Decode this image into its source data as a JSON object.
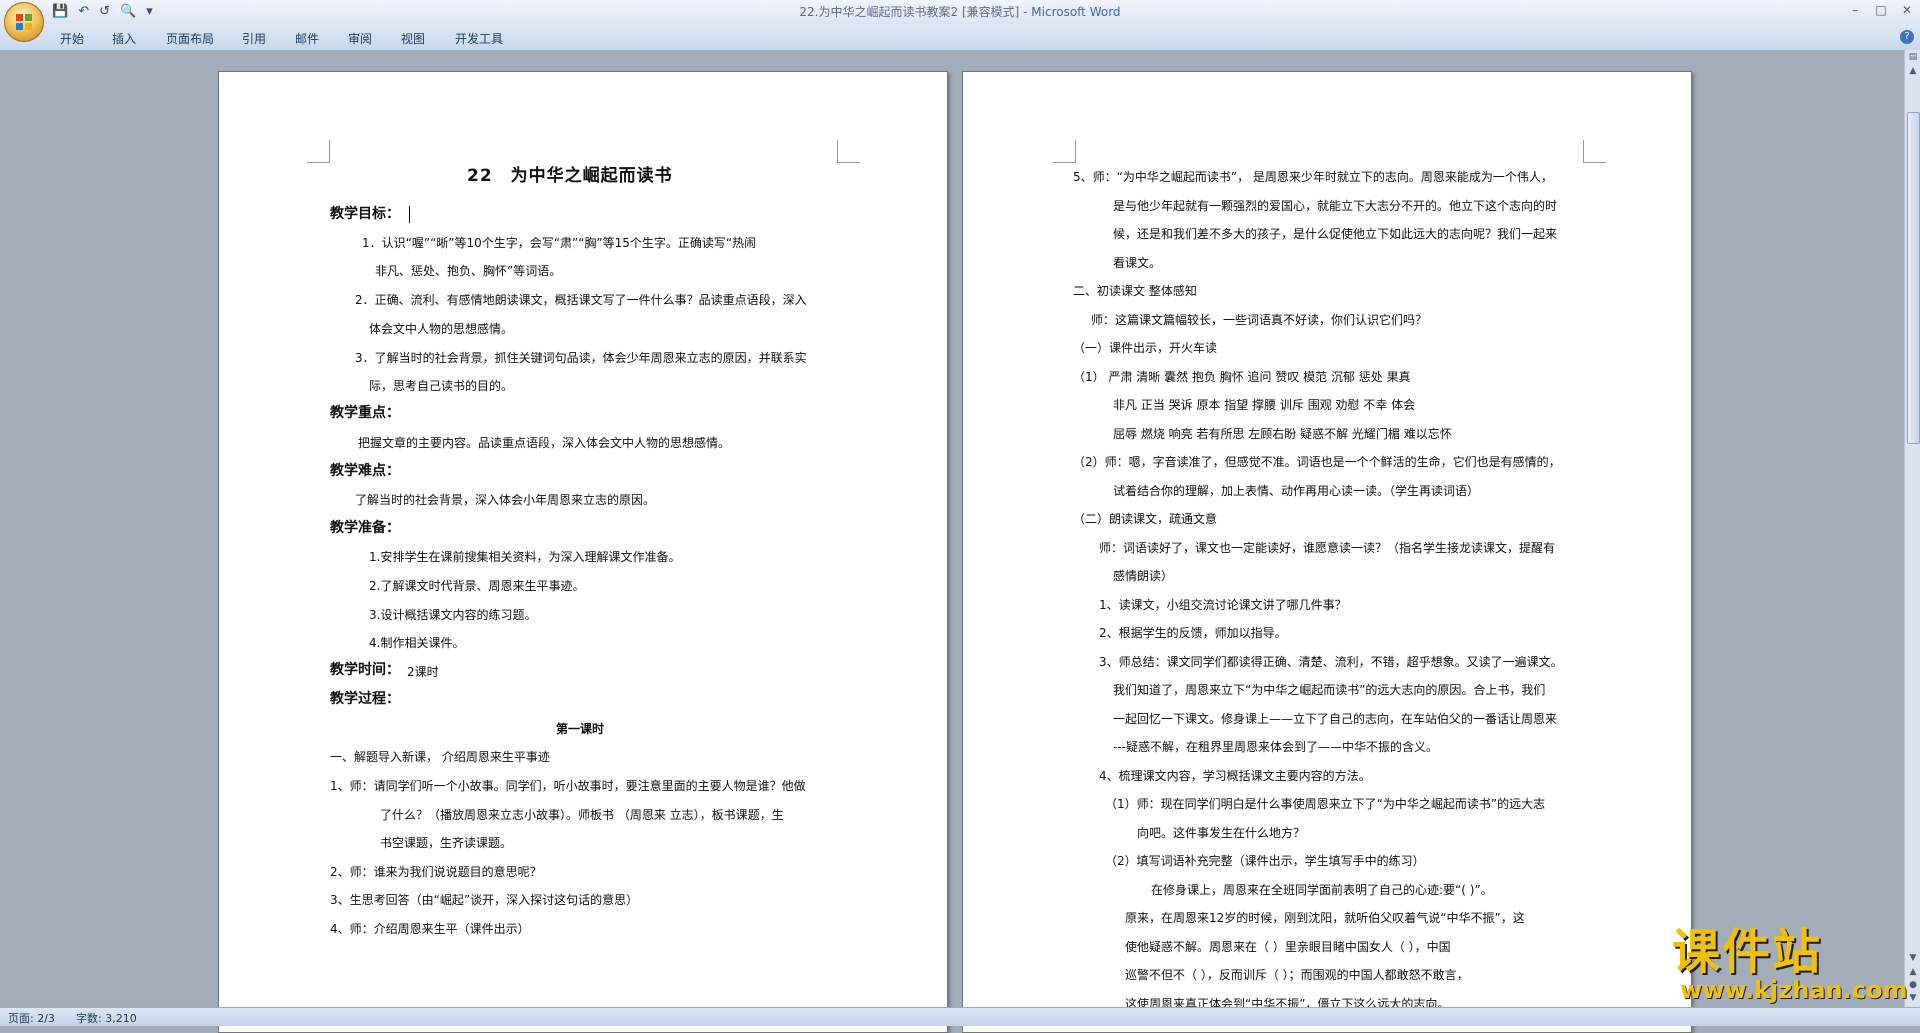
{
  "window": {
    "title": "22.为中华之崛起而读书教案2 [兼容模式] - ",
    "app_name": "Microsoft Word"
  },
  "ribbon_tabs": [
    "开始",
    "插入",
    "页面布局",
    "引用",
    "邮件",
    "审阅",
    "视图",
    "开发工具"
  ],
  "page1": {
    "title": "22　为中华之崛起而读书",
    "lines": [
      "教学目标：",
      "1．认识“喔”“晰”等10个生字，会写“肃”“胸”等15个生字。正确读写“热闹",
      "非凡、惩处、抱负、胸怀”等词语。",
      "2．正确、流利、有感情地朗读课文，概括课文写了一件什么事？品读重点语段，深入",
      "体会文中人物的思想感情。",
      "3．了解当时的社会背景，抓住关键词句品读，体会少年周恩来立志的原因，并联系实",
      "际，思考自己读书的目的。",
      "教学重点：",
      "把握文章的主要内容。品读重点语段，深入体会文中人物的思想感情。",
      "教学难点：",
      "了解当时的社会背景，深入体会小年周恩来立志的原因。",
      "教学准备：",
      "1.安排学生在课前搜集相关资料，为深入理解课文作准备。",
      "2.了解课文时代背景、周恩来生平事迹。",
      "3.设计概括课文内容的练习题。",
      "4.制作相关课件。",
      "教学时间：",
      "2课时",
      "教学过程：",
      "第一课时",
      "一、解题导入新课，  介绍周恩来生平事迹",
      "1、师：请同学们听一个小故事。同学们，听小故事时，要注意里面的主要人物是谁？他做",
      "了什么？（播放周恩来立志小故事）。师板书 （周恩来   立志），板书课题，生",
      "书空课题，生齐读课题。",
      "2、师：谁来为我们说说题目的意思呢？",
      "3、生思考回答（由“崛起”谈开，深入探讨这句话的意思）",
      "4、师：介绍周恩来生平（课件出示）"
    ]
  },
  "page2": {
    "lines": [
      "5、师：“为中华之崛起而读书”， 是周恩来少年时就立下的志向。周恩来能成为一个伟人，",
      "是与他少年起就有一颗强烈的爱国心，就能立下大志分不开的。他立下这个志向的时",
      "候，还是和我们差不多大的孩子，是什么促使他立下如此远大的志向呢？我们一起来",
      "看课文。",
      "二、初读课文 整体感知",
      "师：这篇课文篇幅较长，一些词语真不好读，你们认识它们吗？",
      "（一）课件出示，开火车读",
      "（1）  严肃   清晰   囊然   抱负   胸怀   追问   赞叹   模范   沉郁   惩处   果真",
      "非凡   正当   哭诉   原本   指望   撑腰   训斥   围观   劝慰   不幸   体会",
      "屈辱   燃烧   响亮   若有所思    左顾右盼   疑惑不解   光耀门楣   难以忘怀",
      "（2）师：嗯，字音读准了，但感觉不准。词语也是一个个鲜活的生命，它们也是有感情的，",
      "试着结合你的理解，加上表情、动作再用心读一读。（学生再读词语）",
      "（二）朗读课文，疏通文意",
      "师：词语读好了，课文也一定能读好，谁愿意读一读？（指名学生接龙读课文，提醒有",
      "感情朗读）",
      "1、读课文，小组交流讨论课文讲了哪几件事？",
      "2、根据学生的反馈，师加以指导。",
      "3、师总结：课文同学们都读得正确、清楚、流利，不错，超乎想象。又读了一遍课文。",
      "我们知道了，周恩来立下“为中华之崛起而读书”的远大志向的原因。合上书，我们",
      "一起回忆一下课文。修身课上——立下了自己的志向，在车站伯父的一番话让周恩来",
      "---疑惑不解，在租界里周恩来体会到了——中华不振的含义。",
      "4、梳理课文内容，学习概括课文主要内容的方法。",
      "（1）师：现在同学们明白是什么事使周恩来立下了“为中华之崛起而读书”的远大志",
      "向吧。这件事发生在什么地方？",
      "（2）填写词语补充完整（课件出示，学生填写手中的练习）",
      "在修身课上，周恩来在全班同学面前表明了自己的心迹:要“(                 )”。",
      "原来，在周恩来12岁的时候，刚到沈阳，就听伯父叹着气说“中华不振”，这",
      "使他疑惑不解。周恩来在（       ）里亲眼目睹中国女人（                  ），中国",
      "巡警不但不（          ），反而训斥（          ）；而围观的中国人都敢怒不敢言，",
      "这使周恩来真正体会到“中华不振”，僵立下这么远大的志向。"
    ]
  },
  "status": {
    "page": "页面: 2/3",
    "words": "字数: 3,210"
  },
  "watermark": {
    "text": "课件站",
    "url": "www.kjzhan.com"
  }
}
